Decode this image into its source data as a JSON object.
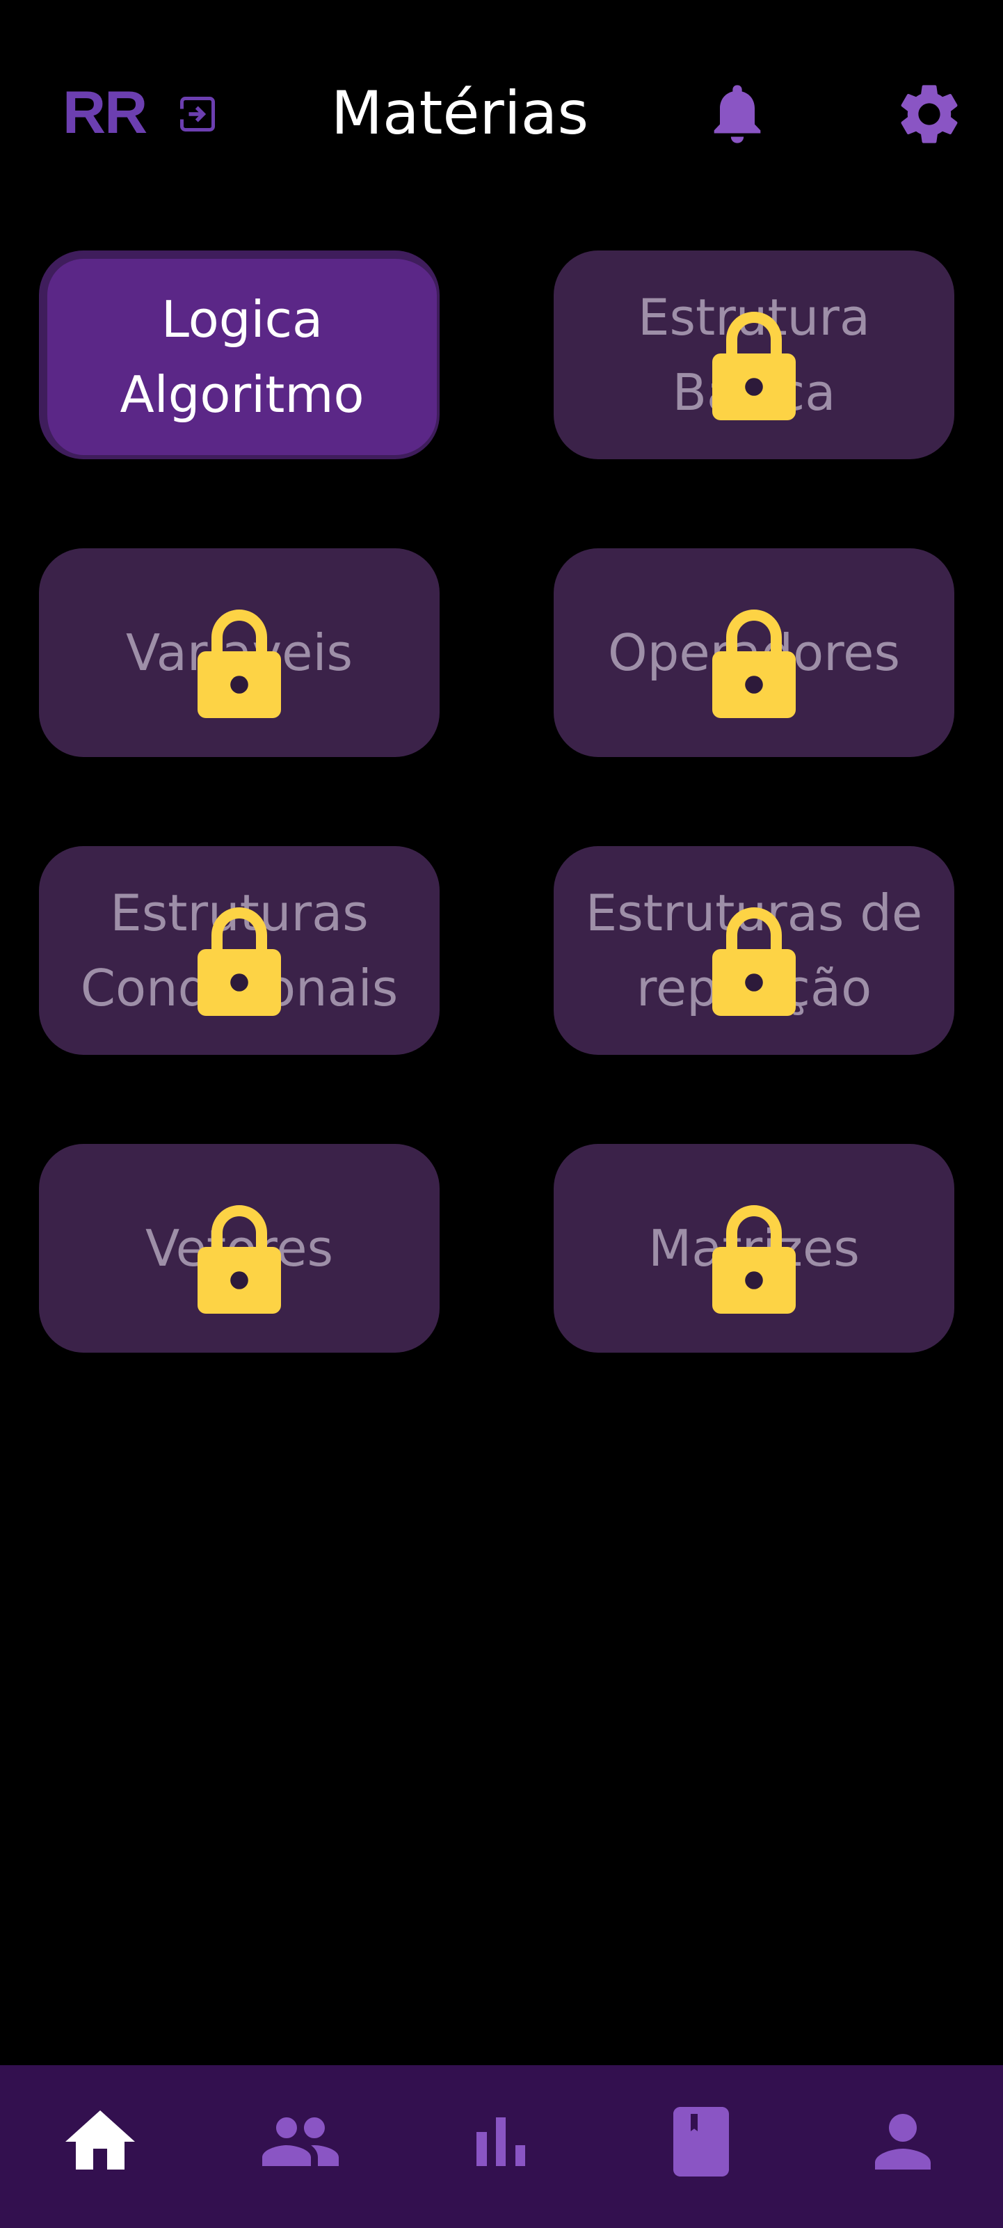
{
  "header": {
    "brand": "RR",
    "title": "Matérias",
    "icons": {
      "logout": "logout-icon",
      "notifications": "bell-icon",
      "settings": "gear-icon"
    }
  },
  "subjects": [
    {
      "label": "Logica Algoritmo",
      "locked": false
    },
    {
      "label": "Estrutura Basica",
      "locked": true
    },
    {
      "label": "Variaveis",
      "locked": true
    },
    {
      "label": "Operadores",
      "locked": true
    },
    {
      "label": "Estruturas Condicionais",
      "locked": true
    },
    {
      "label": "Estruturas de repetição",
      "locked": true
    },
    {
      "label": "Vetores",
      "locked": true
    },
    {
      "label": "Matrizes",
      "locked": true
    }
  ],
  "bottom_nav": {
    "items": [
      {
        "icon": "home-icon",
        "active": true
      },
      {
        "icon": "people-icon",
        "active": false
      },
      {
        "icon": "bar-chart-icon",
        "active": false
      },
      {
        "icon": "book-icon",
        "active": false
      },
      {
        "icon": "person-icon",
        "active": false
      }
    ]
  },
  "colors": {
    "background": "#000000",
    "accent": "#6c3fb0",
    "active_card": "#5b2787",
    "locked_card": "#3b2249",
    "lock": "#fdd345",
    "nav_bar": "#33104f",
    "nav_icon": "#8a55c4"
  }
}
